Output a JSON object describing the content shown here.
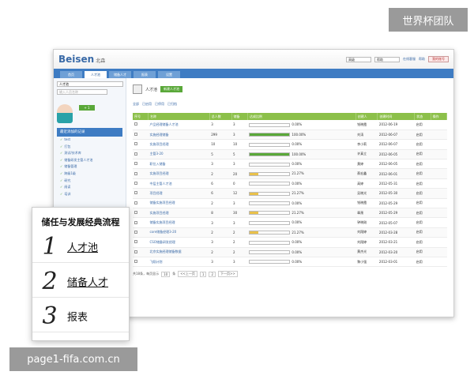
{
  "watermarks": {
    "top_right": "世界杯团队",
    "bottom_left": "page1-fifa.com.cn"
  },
  "app": {
    "logo": "Beisen",
    "logo_cn": "北森",
    "top_select_1": "高级",
    "top_select_2": "帮助",
    "links": [
      "在线客服",
      "帮助"
    ],
    "account_button": "我的账号"
  },
  "nav": {
    "tabs": [
      "首页",
      "人才池",
      "储备人才",
      "报表",
      "设置"
    ],
    "active": 1
  },
  "sidebar": {
    "select_value": "人才池",
    "search_placeholder": "输入人员名称",
    "badge": "+ 1",
    "section_header": "最近添加的记录",
    "tree": [
      "test",
      "打包",
      "测试/技术库",
      "储备研发主管人才池",
      "储备管理",
      "跨级1级",
      "研究",
      "阅读",
      "培训"
    ]
  },
  "main": {
    "title": "人才池",
    "new_button": "新建人才池",
    "filters": [
      "全部",
      "已启用",
      "已停用",
      "已归档"
    ],
    "columns": [
      "序号",
      "名称",
      "总人数",
      "储备",
      "达成比例",
      "创建人",
      "创建时间",
      "状态",
      "操作"
    ],
    "rows": [
      {
        "no": "",
        "name": "产品经理储备人才池",
        "total": "3",
        "reserve": "3",
        "pct": 0,
        "pct_label": "0.00%",
        "creator": "钱晓霞",
        "date": "2012-06-19",
        "status": "启用"
      },
      {
        "no": "",
        "name": "实施经理储备",
        "total": "299",
        "reserve": "3",
        "pct": 100,
        "pct_label": "100.00%",
        "creator": "刘涛",
        "date": "2012-06-07",
        "status": "启用"
      },
      {
        "no": "",
        "name": "实施项目经理",
        "total": "10",
        "reserve": "10",
        "pct": 0,
        "pct_label": "0.00%",
        "creator": "李小莉",
        "date": "2012-06-07",
        "status": "启用"
      },
      {
        "no": "",
        "name": "主管3-20",
        "total": "5",
        "reserve": "5",
        "pct": 100,
        "pct_label": "100.00%",
        "creator": "许真立",
        "date": "2012-06-05",
        "status": "启用"
      },
      {
        "no": "",
        "name": "职位入储备",
        "total": "3",
        "reserve": "3",
        "pct": 0,
        "pct_label": "0.00%",
        "creator": "黄婷",
        "date": "2012-06-05",
        "status": "启用"
      },
      {
        "no": "",
        "name": "实施项目经理",
        "total": "2",
        "reserve": "20",
        "pct": 21,
        "pct_label": "21.27%",
        "creator": "蔡宏鑫",
        "date": "2012-06-01",
        "status": "启用"
      },
      {
        "no": "",
        "name": "中层主管人才池",
        "total": "6",
        "reserve": "0",
        "pct": 0,
        "pct_label": "0.00%",
        "creator": "高婷",
        "date": "2012-05-31",
        "status": "启用"
      },
      {
        "no": "",
        "name": "项目经理",
        "total": "6",
        "reserve": "12",
        "pct": 21,
        "pct_label": "21.27%",
        "creator": "吴晓光",
        "date": "2012-05-30",
        "status": "启用"
      },
      {
        "no": "",
        "name": "储备实施项目经理",
        "total": "2",
        "reserve": "3",
        "pct": 0,
        "pct_label": "0.00%",
        "creator": "钱晓霞",
        "date": "2012-05-29",
        "status": "启用"
      },
      {
        "no": "",
        "name": "实施项目经理",
        "total": "8",
        "reserve": "30",
        "pct": 21,
        "pct_label": "21.27%",
        "creator": "章萧",
        "date": "2012-05-29",
        "status": "启用"
      },
      {
        "no": "",
        "name": "储备实施项目经理",
        "total": "3",
        "reserve": "3",
        "pct": 0,
        "pct_label": "0.00%",
        "creator": "钟晓刚",
        "date": "2012-05-07",
        "status": "启用"
      },
      {
        "no": "",
        "name": "core储备经理3-20",
        "total": "2",
        "reserve": "2",
        "pct": 21,
        "pct_label": "21.27%",
        "creator": "刘翔婷",
        "date": "2012-03-28",
        "status": "启用"
      },
      {
        "no": "",
        "name": "CSO储备研发经理",
        "total": "3",
        "reserve": "2",
        "pct": 0,
        "pct_label": "0.00%",
        "creator": "刘翔婷",
        "date": "2012-03-21",
        "status": "启用"
      },
      {
        "no": "",
        "name": "北京实施经理储备数据",
        "total": "2",
        "reserve": "2",
        "pct": 0,
        "pct_label": "0.00%",
        "creator": "黄杰光",
        "date": "2012-03-20",
        "status": "启用"
      },
      {
        "no": "",
        "name": "飞翔计划",
        "total": "3",
        "reserve": "3",
        "pct": 0,
        "pct_label": "0.00%",
        "creator": "黎小强",
        "date": "2012-03-01",
        "status": "启用"
      }
    ],
    "pager": {
      "summary": "共18条，每页显示",
      "per_page": "10",
      "suffix": "条",
      "prev": "<<上一页",
      "pages": [
        "1",
        "2"
      ],
      "next": "下一页>>"
    }
  },
  "overlay": {
    "title": "储任与发展经典流程",
    "items": [
      {
        "num": "1",
        "label": "人才池"
      },
      {
        "num": "2",
        "label": "储备人才"
      },
      {
        "num": "3",
        "label": "报表"
      }
    ]
  }
}
